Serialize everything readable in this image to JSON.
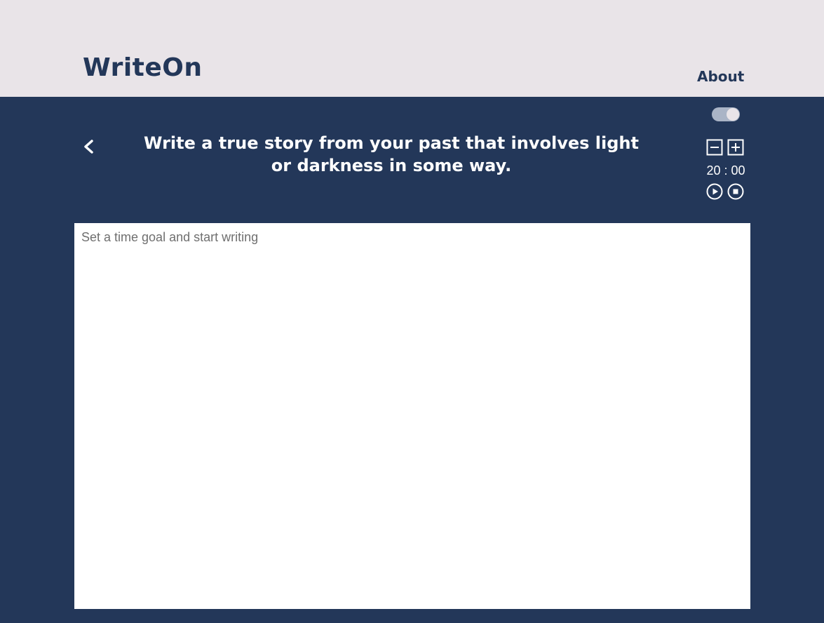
{
  "header": {
    "logo": "WriteOn",
    "nav_about": "About"
  },
  "prompt": {
    "text": "Write a true story from your past that involves light or darkness in some way."
  },
  "timer": {
    "display": "20 : 00"
  },
  "editor": {
    "placeholder": "Set a time goal and start writing",
    "value": ""
  },
  "icons": {
    "toggle": "theme-toggle",
    "back": "chevron-left-icon",
    "decrease": "minus-square-icon",
    "increase": "plus-square-icon",
    "play": "play-circle-icon",
    "stop": "stop-circle-icon"
  },
  "colors": {
    "header_bg": "#e9e4e8",
    "main_bg": "#233759",
    "editor_bg": "#ffffff",
    "text_light": "#ffffff",
    "brand_text": "#233759",
    "toggle_track": "#aab4c6"
  }
}
